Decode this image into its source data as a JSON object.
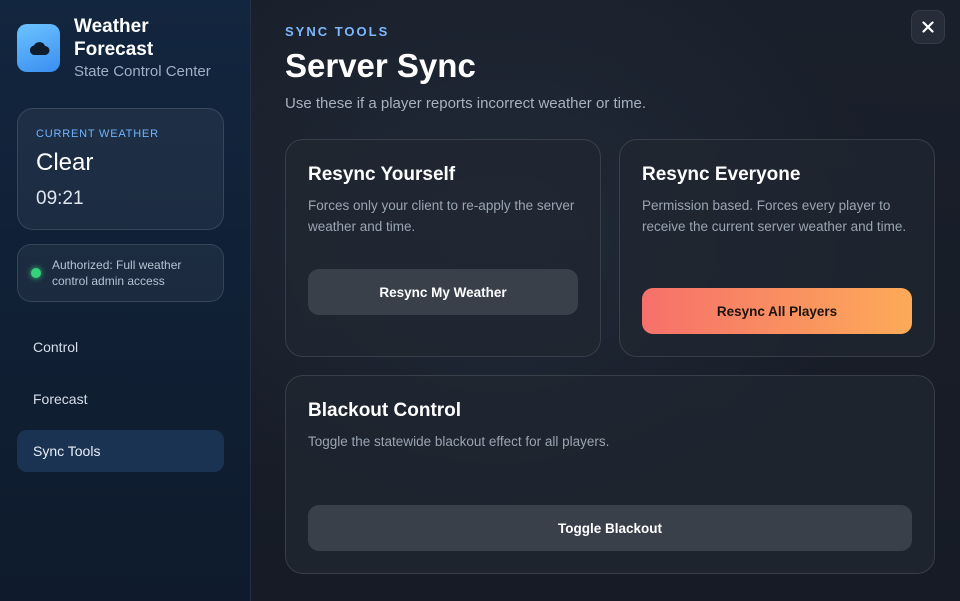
{
  "brand": {
    "title": "Weather Forecast",
    "subtitle": "State Control Center",
    "icon": "cloud-icon",
    "colors": {
      "logo_start": "#6cc3ff",
      "logo_end": "#3a8ef0"
    }
  },
  "current_weather": {
    "label": "CURRENT WEATHER",
    "condition": "Clear",
    "time": "09:21"
  },
  "auth": {
    "status_color": "#34d27a",
    "text": "Authorized: Full weather control admin access"
  },
  "nav": {
    "items": [
      {
        "label": "Control",
        "active": false
      },
      {
        "label": "Forecast",
        "active": false
      },
      {
        "label": "Sync Tools",
        "active": true
      }
    ]
  },
  "header": {
    "eyebrow": "SYNC TOOLS",
    "title": "Server Sync",
    "subtitle": "Use these if a player reports incorrect weather or time.",
    "close_icon": "close-icon"
  },
  "cards": {
    "resync_self": {
      "title": "Resync Yourself",
      "description": "Forces only your client to re-apply the server weather and time.",
      "button": "Resync My Weather"
    },
    "resync_all": {
      "title": "Resync Everyone",
      "description": "Permission based. Forces every player to receive the current server weather and time.",
      "button": "Resync All Players",
      "colors": {
        "button_start": "#f6706a",
        "button_end": "#fdab58"
      }
    },
    "blackout": {
      "title": "Blackout Control",
      "description": "Toggle the statewide blackout effect for all players.",
      "button": "Toggle Blackout"
    }
  },
  "theme": {
    "accent": "#7eb8ff",
    "sidebar_active": "#1b3352"
  }
}
